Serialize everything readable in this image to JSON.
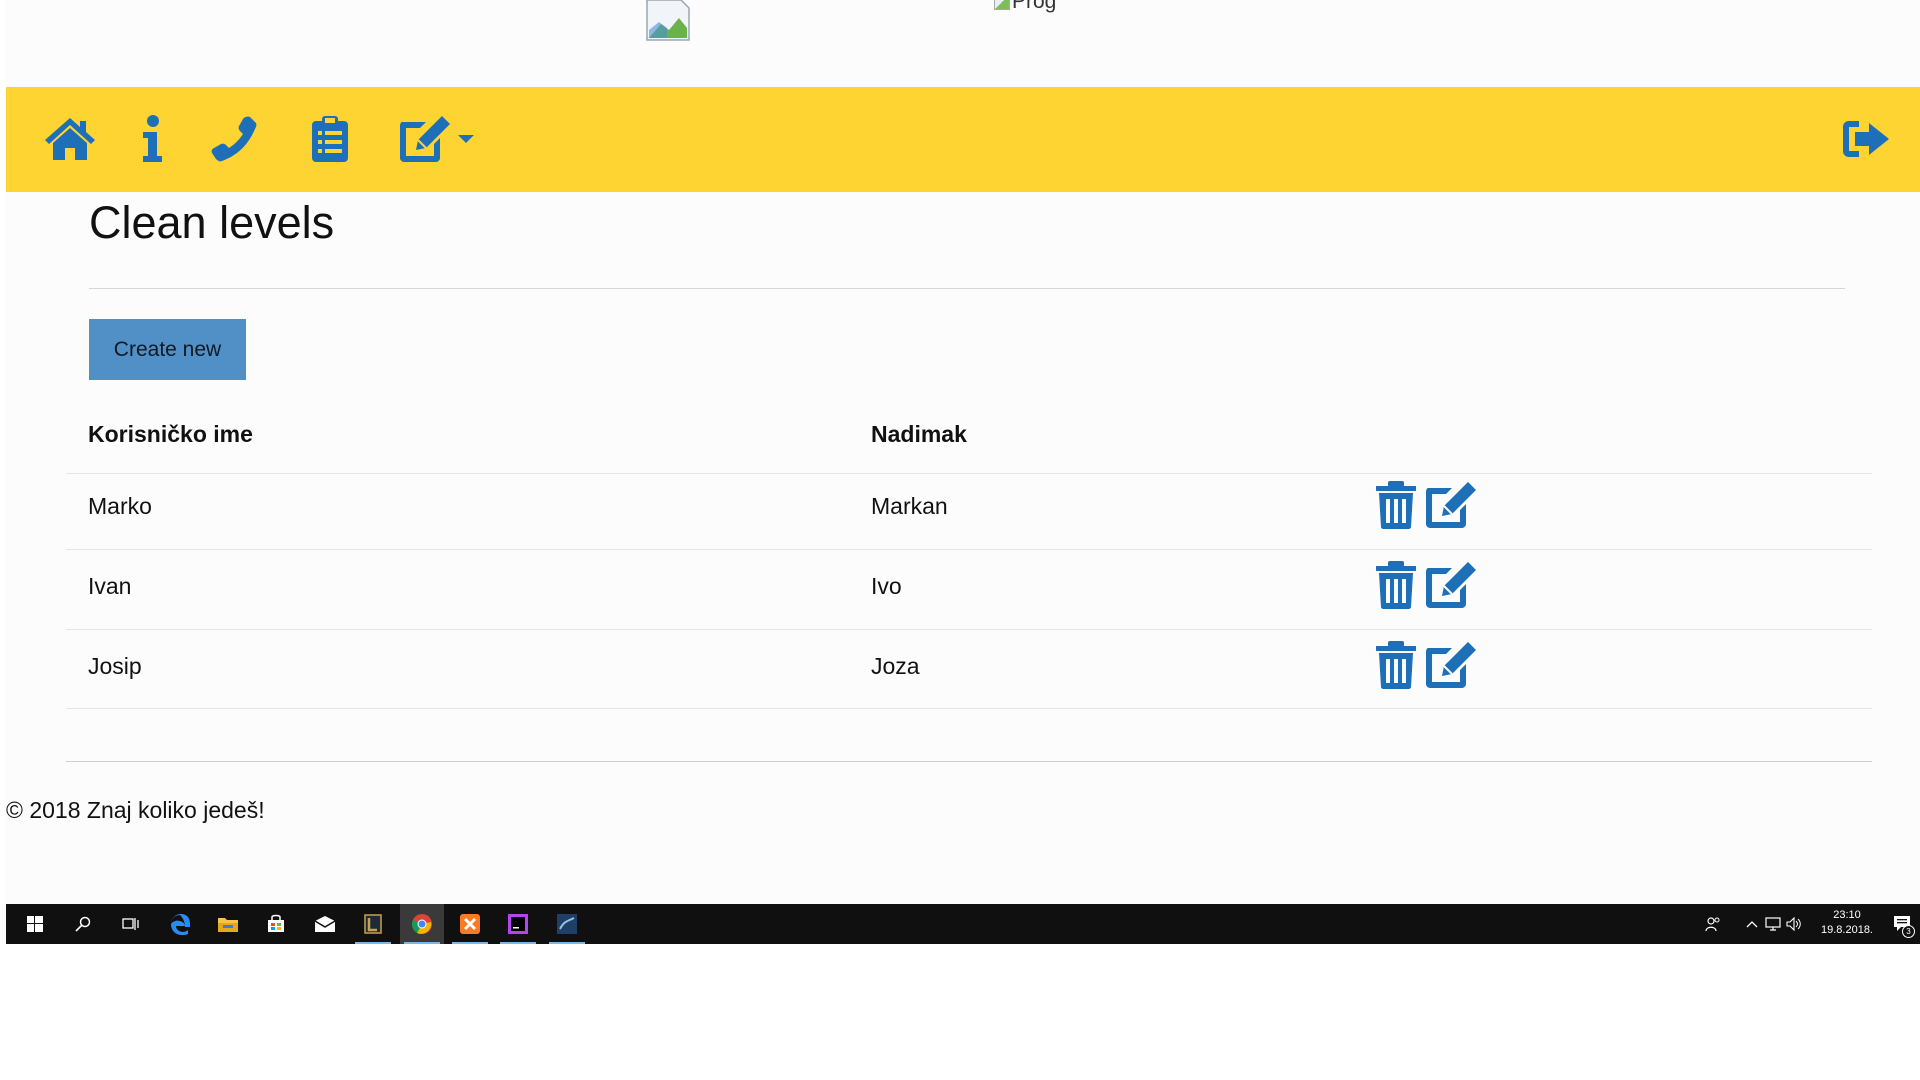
{
  "header": {
    "logo_alt": "Prog"
  },
  "navbar": {
    "background": "#fdd432",
    "icon_color": "#1d6fb8",
    "items": [
      {
        "name": "home-icon"
      },
      {
        "name": "info-icon"
      },
      {
        "name": "phone-icon"
      },
      {
        "name": "clipboard-list-icon"
      },
      {
        "name": "edit-dropdown-icon"
      }
    ],
    "logout_icon": "sign-out-icon"
  },
  "main": {
    "title": "Clean levels",
    "create_button_label": "Create new",
    "table": {
      "headers": [
        "Korisničko ime",
        "Nadimak"
      ],
      "rows": [
        {
          "username": "Marko",
          "nickname": "Markan"
        },
        {
          "username": "Ivan",
          "nickname": "Ivo"
        },
        {
          "username": "Josip",
          "nickname": "Joza"
        }
      ]
    }
  },
  "footer": {
    "text": "© 2018 Znaj koliko jedeš!"
  },
  "taskbar": {
    "apps": [
      "start-icon",
      "search-icon",
      "task-view-icon",
      "edge-icon",
      "file-explorer-icon",
      "store-icon",
      "mail-icon",
      "app-icon",
      "chrome-icon",
      "xampp-icon",
      "phpstorm-icon",
      "mysql-workbench-icon"
    ],
    "time": "23:10",
    "date": "19.8.2018.",
    "notification_count": "3"
  }
}
